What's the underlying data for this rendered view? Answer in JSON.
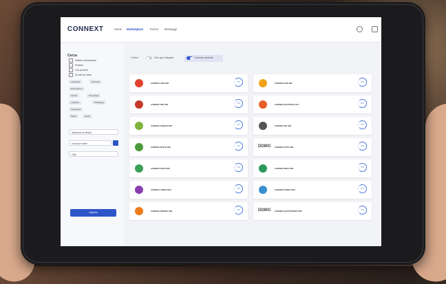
{
  "app": {
    "logo": "CONNEXT"
  },
  "nav": {
    "items": [
      "Home",
      "Marketplace",
      "Eventi",
      "Messaggi"
    ]
  },
  "filters": {
    "title": "Cerca",
    "checks": [
      "Visibili e interessanti",
      "Preferiti",
      "Con prodotti",
      "Sconti nel mese"
    ],
    "chips": [
      "Alimentari",
      "Bevande",
      "Ristorazione",
      "Servizi",
      "Tecnologia",
      "Logistica",
      "Packaging",
      "Agricoltura",
      "Moda",
      "Retail"
    ],
    "selects": [
      "Seleziona un settore",
      "Cerca per nome",
      "Città"
    ],
    "apply_label": "Applica"
  },
  "toolbar": {
    "sort_label": "Ordina",
    "toggle1_label": "Solo già collegate",
    "toggle2_label": "Aziende preferite"
  },
  "companies": [
    {
      "name": "AZIENDA UNO SPA",
      "logo_color": "#e0422e",
      "ring": "75%"
    },
    {
      "name": "AZIENDA DUE SRL",
      "logo_color": "#f3a21b",
      "ring": "75%"
    },
    {
      "name": "AZIENDA TRE SRL",
      "logo_color": "#c53a2a",
      "ring": "70%"
    },
    {
      "name": "AZIENDA QUATTRO S.R.L.",
      "logo_color": "#e85f2a",
      "ring": "80%"
    },
    {
      "name": "AZIENDA CINQUE SPA",
      "logo_color": "#7fb23a",
      "ring": "70%"
    },
    {
      "name": "AZIENDA SEI SRL",
      "logo_color": "#555555",
      "ring": "75%"
    },
    {
      "name": "AZIENDA SETTE SRL",
      "logo_color": "#4a9a3a",
      "ring": "75%"
    },
    {
      "name": "AZIENDA OTTO SRL",
      "logo_color": "#444444",
      "ring": "75%",
      "text_logo": "DDMO"
    },
    {
      "name": "AZIENDA NOVE SRL",
      "logo_color": "#3aa056",
      "ring": "70%"
    },
    {
      "name": "AZIENDA DIECI SRL",
      "logo_color": "#2d9a5c",
      "ring": "75%"
    },
    {
      "name": "AZIENDA UNDICI SPA",
      "logo_color": "#8a3fb0",
      "ring": "75%"
    },
    {
      "name": "AZIENDA DODICI SPA",
      "logo_color": "#3a8fd0",
      "ring": "70%"
    },
    {
      "name": "AZIENDA TREDICI SRL",
      "logo_color": "#f07a1a",
      "ring": "75%"
    },
    {
      "name": "AZIENDA QUATTORDICI SPA",
      "logo_color": "#444444",
      "ring": "75%",
      "text_logo": "DDMO"
    }
  ]
}
